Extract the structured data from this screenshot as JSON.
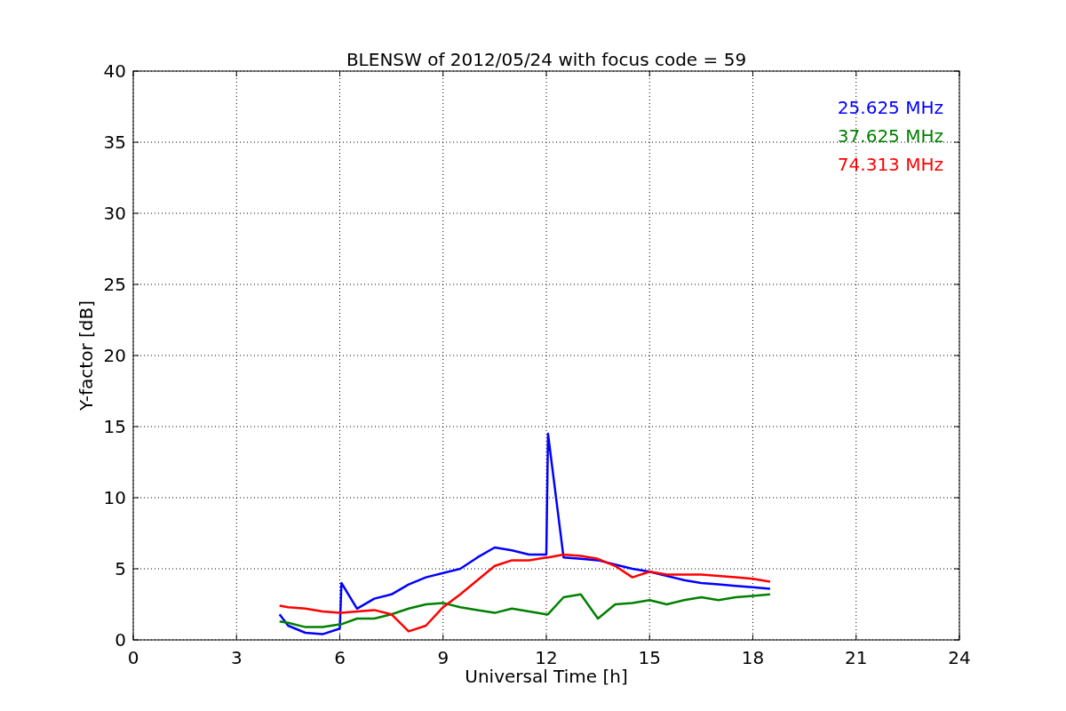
{
  "figure": {
    "chart_data": {
      "type": "line",
      "title": "BLENSW of 2012/05/24 with focus code = 59",
      "xlabel": "Universal Time [h]",
      "ylabel": "Y-factor [dB]",
      "x": [
        4.25,
        4.5,
        5,
        5.5,
        6,
        6.05,
        6.5,
        7,
        7.5,
        8,
        8.5,
        9,
        9.5,
        10,
        10.5,
        11,
        11.5,
        12,
        12.05,
        12.5,
        13,
        13.5,
        14,
        14.5,
        15,
        15.5,
        16,
        16.5,
        17,
        17.5,
        18,
        18.5
      ],
      "series": [
        {
          "name": "25.625 MHz",
          "color": "#0000ff",
          "values": [
            1.8,
            1.0,
            0.5,
            0.4,
            0.8,
            4.0,
            2.2,
            2.9,
            3.2,
            3.9,
            4.4,
            4.7,
            5.0,
            5.8,
            6.5,
            6.3,
            6.0,
            6.0,
            14.5,
            5.8,
            5.7,
            5.6,
            5.3,
            5.0,
            4.8,
            4.5,
            4.2,
            4.0,
            3.9,
            3.8,
            3.7,
            3.6
          ]
        },
        {
          "name": "37.625 MHz",
          "color": "#008000",
          "values": [
            1.3,
            1.2,
            0.9,
            0.9,
            1.1,
            1.1,
            1.5,
            1.5,
            1.8,
            2.2,
            2.5,
            2.6,
            2.3,
            2.1,
            1.9,
            2.2,
            2.0,
            1.8,
            1.8,
            3.0,
            3.2,
            1.5,
            2.5,
            2.6,
            2.8,
            2.5,
            2.8,
            3.0,
            2.8,
            3.0,
            3.1,
            3.2
          ]
        },
        {
          "name": "74.313 MHz",
          "color": "#ff0000",
          "values": [
            2.4,
            2.3,
            2.2,
            2.0,
            1.9,
            1.9,
            2.0,
            2.1,
            1.8,
            0.6,
            1.0,
            2.3,
            3.2,
            4.2,
            5.2,
            5.6,
            5.6,
            5.8,
            5.8,
            6.0,
            5.9,
            5.7,
            5.2,
            4.4,
            4.8,
            4.6,
            4.6,
            4.6,
            4.5,
            4.4,
            4.3,
            4.1
          ]
        }
      ],
      "grid": true,
      "xlim": [
        0,
        24
      ],
      "ylim": [
        0,
        40
      ],
      "xticks": [
        0,
        3,
        6,
        9,
        12,
        15,
        18,
        21,
        24
      ],
      "yticks": [
        0,
        5,
        10,
        15,
        20,
        25,
        30,
        35,
        40
      ]
    }
  }
}
